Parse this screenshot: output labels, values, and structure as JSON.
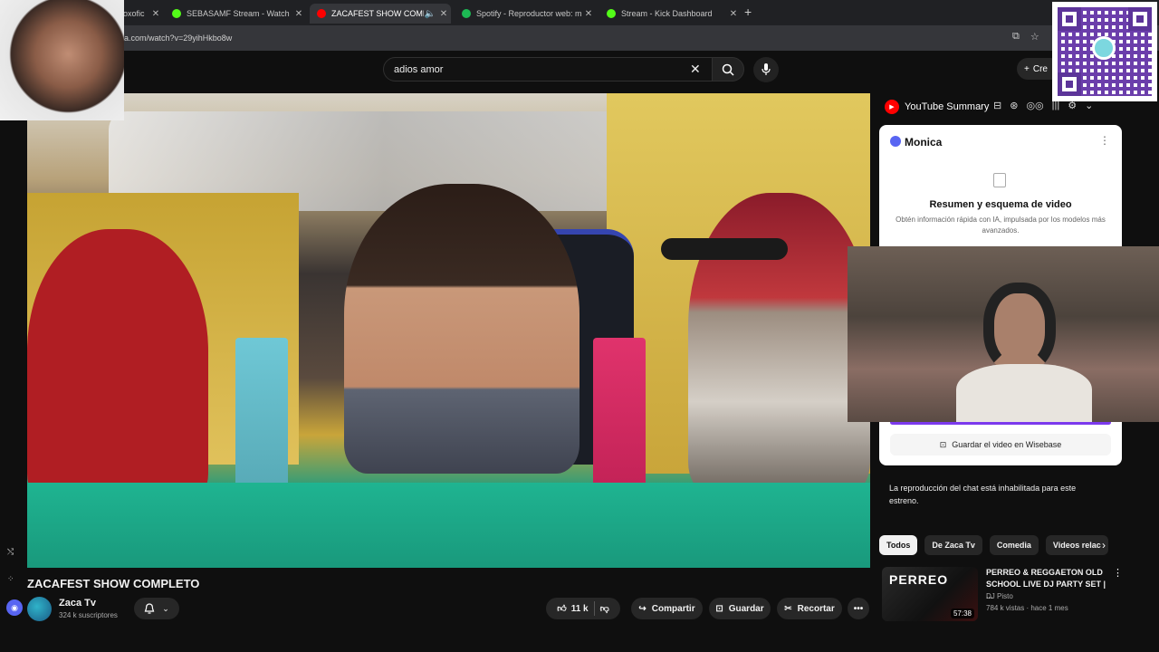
{
  "browser": {
    "tabs": [
      {
        "title": "oxofic",
        "icon_color": "#777777"
      },
      {
        "title": "SEBASAMF Stream - Watch Live",
        "icon_color": "#53fc18"
      },
      {
        "title": "ZACAFEST SHOW COMPLETO",
        "icon_color": "#ff0000"
      },
      {
        "title": "Spotify - Reproductor web: música",
        "icon_color": "#1db954"
      },
      {
        "title": "Stream - Kick Dashboard",
        "icon_color": "#53fc18"
      }
    ],
    "url": "a.com/watch?v=29yihHkbo8w"
  },
  "youtube": {
    "search_value": "adios amor",
    "create_label": "Cre"
  },
  "video": {
    "title": "ZACAFEST SHOW COMPLETO",
    "channel": "Zaca Tv",
    "subscribers": "324 k suscriptores",
    "likes": "11 k",
    "share_label": "Compartir",
    "save_label": "Guardar",
    "clip_label": "Recortar"
  },
  "extension": {
    "name": "YouTube Summary",
    "assistant": "Monica",
    "summary_title": "Resumen y esquema de video",
    "summary_desc": "Obtén información rápida con IA, impulsada por los modelos más avanzados.",
    "wisebase_label": "Guardar el video en Wisebase"
  },
  "chat": {
    "disabled_text": "La reproducción del chat está inhabilitada para este estreno."
  },
  "chips": [
    "Todos",
    "De Zaca Tv",
    "Comedia",
    "Videos relac"
  ],
  "recommendation": {
    "thumb_text": "PERREO",
    "title": "PERREO & REGGAETON OLD SCHOOL LIVE DJ PARTY SET | ...",
    "channel": "DJ Pisto",
    "meta": "784 k vistas · hace 1 mes",
    "duration": "57:38"
  },
  "colors": {
    "background": "#0f0f0f",
    "accent": "#7c3aed",
    "youtube_red": "#ff0000"
  }
}
